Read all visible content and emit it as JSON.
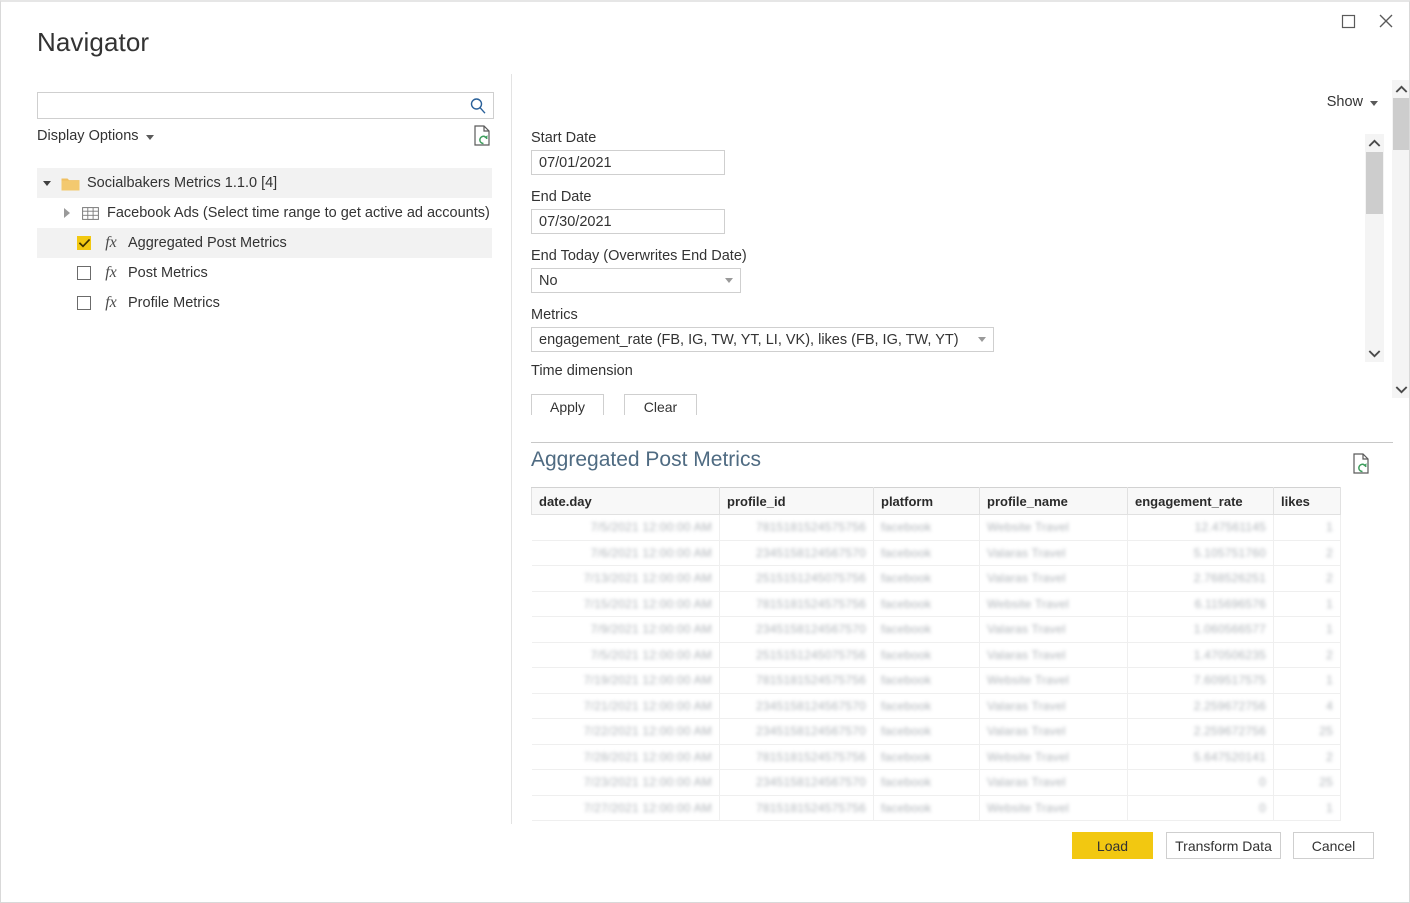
{
  "window": {
    "title": "Navigator",
    "maximize_icon": "maximize-icon",
    "close_icon": "close-icon"
  },
  "left_pane": {
    "search": {
      "value": "",
      "placeholder": "",
      "icon": "search-icon"
    },
    "display_options_label": "Display Options",
    "refresh_icon": "refresh-preview-icon",
    "tree": [
      {
        "label": "Socialbakers Metrics 1.1.0 [4]",
        "icon": "folder-icon",
        "expanded": true,
        "level": 0,
        "checkbox": false,
        "selected": true
      },
      {
        "label": "Facebook Ads (Select time range to get active ad accounts)",
        "icon": "table-icon",
        "expanded": false,
        "level": 1,
        "checkbox": false,
        "selected": false
      },
      {
        "label": "Aggregated Post Metrics",
        "icon": "function-icon",
        "level": 1,
        "checkbox": true,
        "checked": true,
        "selected": true
      },
      {
        "label": "Post Metrics",
        "icon": "function-icon",
        "level": 1,
        "checkbox": true,
        "checked": false,
        "selected": false
      },
      {
        "label": "Profile Metrics",
        "icon": "function-icon",
        "level": 1,
        "checkbox": true,
        "checked": false,
        "selected": false
      }
    ]
  },
  "right_pane": {
    "show_label": "Show",
    "parameters": {
      "start_date": {
        "label": "Start Date",
        "value": "07/01/2021"
      },
      "end_date": {
        "label": "End Date",
        "value": "07/30/2021"
      },
      "end_today": {
        "label": "End Today (Overwrites End Date)",
        "value": "No"
      },
      "metrics": {
        "label": "Metrics",
        "value": "engagement_rate (FB, IG, TW, YT, LI, VK), likes (FB, IG, TW, YT)"
      },
      "time_dimension": {
        "label": "Time dimension",
        "value": ""
      },
      "apply_label": "Apply",
      "clear_label": "Clear"
    },
    "preview": {
      "title": "Aggregated Post Metrics",
      "refresh_icon": "refresh-preview-icon",
      "columns": [
        "date.day",
        "profile_id",
        "platform",
        "profile_name",
        "engagement_rate",
        "likes"
      ],
      "rows": [
        [
          "7/5/2021 12:00:00 AM",
          "7815181524575756",
          "facebook",
          "Website Travel",
          "12.47561145",
          "1"
        ],
        [
          "7/6/2021 12:00:00 AM",
          "2345158124567570",
          "facebook",
          "Valaras Travel",
          "5.105751760",
          "2"
        ],
        [
          "7/13/2021 12:00:00 AM",
          "2515151245075756",
          "facebook",
          "Valaras Travel",
          "2.768526251",
          "2"
        ],
        [
          "7/15/2021 12:00:00 AM",
          "7815181524575756",
          "facebook",
          "Website Travel",
          "6.115696576",
          "1"
        ],
        [
          "7/9/2021 12:00:00 AM",
          "2345158124567570",
          "facebook",
          "Valaras Travel",
          "1.060566577",
          "1"
        ],
        [
          "7/5/2021 12:00:00 AM",
          "2515151245075756",
          "facebook",
          "Valaras Travel",
          "1.470506235",
          "2"
        ],
        [
          "7/19/2021 12:00:00 AM",
          "7815181524575756",
          "facebook",
          "Website Travel",
          "7.609517575",
          "1"
        ],
        [
          "7/21/2021 12:00:00 AM",
          "2345158124567570",
          "facebook",
          "Valaras Travel",
          "2.259672756",
          "4"
        ],
        [
          "7/22/2021 12:00:00 AM",
          "2345158124567570",
          "facebook",
          "Valaras Travel",
          "2.259672756",
          "25"
        ],
        [
          "7/28/2021 12:00:00 AM",
          "7815181524575756",
          "facebook",
          "Website Travel",
          "5.647520141",
          "2"
        ],
        [
          "7/23/2021 12:00:00 AM",
          "2345158124567570",
          "facebook",
          "Valaras Travel",
          "0",
          "25"
        ],
        [
          "7/27/2021 12:00:00 AM",
          "7815181524575756",
          "facebook",
          "Website Travel",
          "0",
          "1"
        ]
      ]
    }
  },
  "footer": {
    "load_label": "Load",
    "transform_label": "Transform Data",
    "cancel_label": "Cancel"
  },
  "colors": {
    "accent": "#f2c811",
    "preview_title": "#4f6b82",
    "search_icon": "#2a6099",
    "folder": "#f0c061"
  }
}
